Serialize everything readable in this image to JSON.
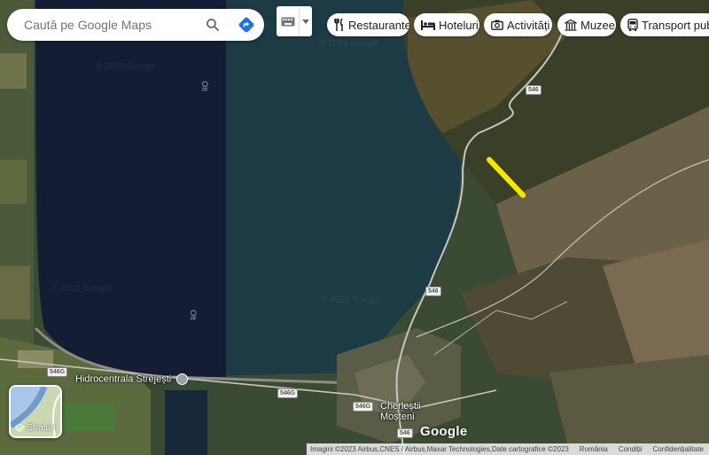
{
  "search": {
    "placeholder": "Caută pe Google Maps"
  },
  "chips": [
    {
      "label": "Restaurante",
      "icon": "fork-knife-icon"
    },
    {
      "label": "Hoteluri",
      "icon": "bed-icon"
    },
    {
      "label": "Activități",
      "icon": "camera-icon"
    },
    {
      "label": "Muzee",
      "icon": "museum-icon"
    },
    {
      "label": "Transport public",
      "icon": "bus-icon"
    }
  ],
  "map": {
    "places": {
      "dam": "Hidrocentrala Strejești",
      "village_line1": "Cherleștii",
      "village_line2": "Moșteni"
    },
    "roads": {
      "r546": "546",
      "r546g": "546G"
    },
    "river": "Olt",
    "watermark": "© 2023 Google"
  },
  "layers": {
    "label": "Straturi"
  },
  "brand": "Google",
  "footer": {
    "imagery": "Imagini ©2023 Airbus,CNES / Airbus,Maxar Technologies,Date cartografice ©2023",
    "country": "România",
    "terms": "Condiții",
    "privacy": "Confidențialitate"
  },
  "colors": {
    "highlight": "#f5e900",
    "accent_blue": "#1a73e8"
  }
}
